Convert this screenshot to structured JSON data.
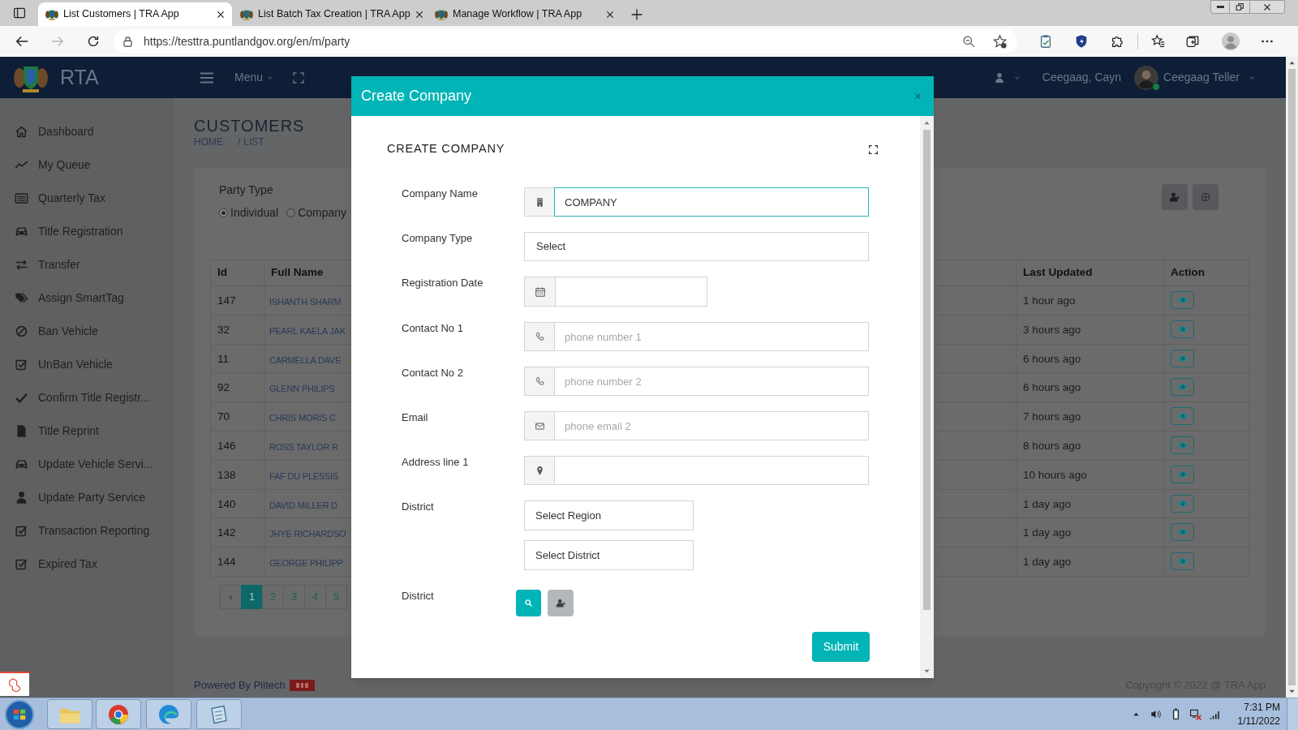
{
  "browser": {
    "tabs": [
      {
        "title": "List Customers | TRA App",
        "selected": true
      },
      {
        "title": "List Batch Tax Creation | TRA App",
        "selected": false
      },
      {
        "title": "Manage Workflow | TRA App",
        "selected": false
      }
    ],
    "url": "https://testtra.puntlandgov.org/en/m/party"
  },
  "app_header": {
    "brand": "RTA",
    "menu": "Menu",
    "user_short": "Ceegaag, Cayn",
    "user_name": "Ceegaag Teller",
    "user_online": true
  },
  "sidebar": {
    "items": [
      {
        "label": "Dashboard"
      },
      {
        "label": "My Queue"
      },
      {
        "label": "Quarterly Tax"
      },
      {
        "label": "Title Registration"
      },
      {
        "label": "Transfer"
      },
      {
        "label": "Assign SmartTag"
      },
      {
        "label": "Ban Vehicle"
      },
      {
        "label": "UnBan Vehicle"
      },
      {
        "label": "Confirm Title Registr..."
      },
      {
        "label": "Title Reprint"
      },
      {
        "label": "Update Vehicle Servi..."
      },
      {
        "label": "Update Party Service"
      },
      {
        "label": "Transaction Reporting"
      },
      {
        "label": "Expired Tax"
      }
    ]
  },
  "page": {
    "title": "CUSTOMERS",
    "breadcrumb": {
      "items": [
        "HOME",
        "LIST"
      ],
      "separator": "/"
    },
    "party_type": {
      "label": "Party Type",
      "options": [
        {
          "label": "Individual",
          "selected": true
        },
        {
          "label": "Company",
          "selected": false
        }
      ]
    },
    "table": {
      "columns": [
        "Id",
        "Full Name",
        "Last Updated",
        "Action"
      ],
      "rows": [
        {
          "id": "147",
          "full_name": "ISHANTH SHARM",
          "last_updated": "1 hour ago"
        },
        {
          "id": "32",
          "full_name": "PEARL KAELA JAK",
          "last_updated": "3 hours ago"
        },
        {
          "id": "11",
          "full_name": "CARMELLA DAVE",
          "last_updated": "6 hours ago"
        },
        {
          "id": "92",
          "full_name": "GLENN PHILIPS",
          "last_updated": "6 hours ago"
        },
        {
          "id": "70",
          "full_name": "CHRIS MORIS C",
          "last_updated": "7 hours ago"
        },
        {
          "id": "146",
          "full_name": "ROSS TAYLOR R",
          "last_updated": "8 hours ago"
        },
        {
          "id": "138",
          "full_name": "FAF DU PLESSIS",
          "last_updated": "10 hours ago"
        },
        {
          "id": "140",
          "full_name": "DAVID MILLER D",
          "last_updated": "1 day ago"
        },
        {
          "id": "142",
          "full_name": "JHYE RICHARDSO",
          "last_updated": "1 day ago"
        },
        {
          "id": "144",
          "full_name": "GEORGE PHILIPP",
          "last_updated": "1 day ago"
        }
      ]
    },
    "pagination": [
      {
        "label": "‹",
        "selected": false,
        "disabled": true
      },
      {
        "label": "1",
        "selected": true,
        "disabled": false
      },
      {
        "label": "2",
        "selected": false,
        "disabled": false
      },
      {
        "label": "3",
        "selected": false,
        "disabled": false
      },
      {
        "label": "4",
        "selected": false,
        "disabled": false
      },
      {
        "label": "5",
        "selected": false,
        "disabled": false
      }
    ]
  },
  "footer": {
    "powered_by": "Powered By Piitech",
    "copyright": "Copyright © 2022 @ TRA App"
  },
  "modal": {
    "title": "Create Company",
    "heading": "CREATE COMPANY",
    "fields": [
      {
        "kind": "input",
        "label": "Company Name",
        "value": "COMPANY",
        "focused": true
      },
      {
        "kind": "select",
        "label": "Company Type",
        "value": "Select"
      },
      {
        "kind": "date",
        "label": "Registration Date"
      },
      {
        "kind": "input",
        "label": "Contact No 1",
        "placeholder": "phone number 1",
        "focused": false
      },
      {
        "kind": "input",
        "label": "Contact No 2",
        "placeholder": "phone number 2",
        "focused": false
      },
      {
        "kind": "input",
        "label": "Email",
        "placeholder": "phone email 2",
        "focused": false
      },
      {
        "kind": "input",
        "label": "Address line 1",
        "focused": false
      },
      {
        "kind": "select_pair",
        "label": "District",
        "options": [
          "Select Region",
          "Select District"
        ]
      },
      {
        "kind": "buttons",
        "label": "District"
      }
    ],
    "submit": "Submit"
  },
  "taskbar": {
    "time": "7:31 PM",
    "date": "1/11/2022"
  }
}
